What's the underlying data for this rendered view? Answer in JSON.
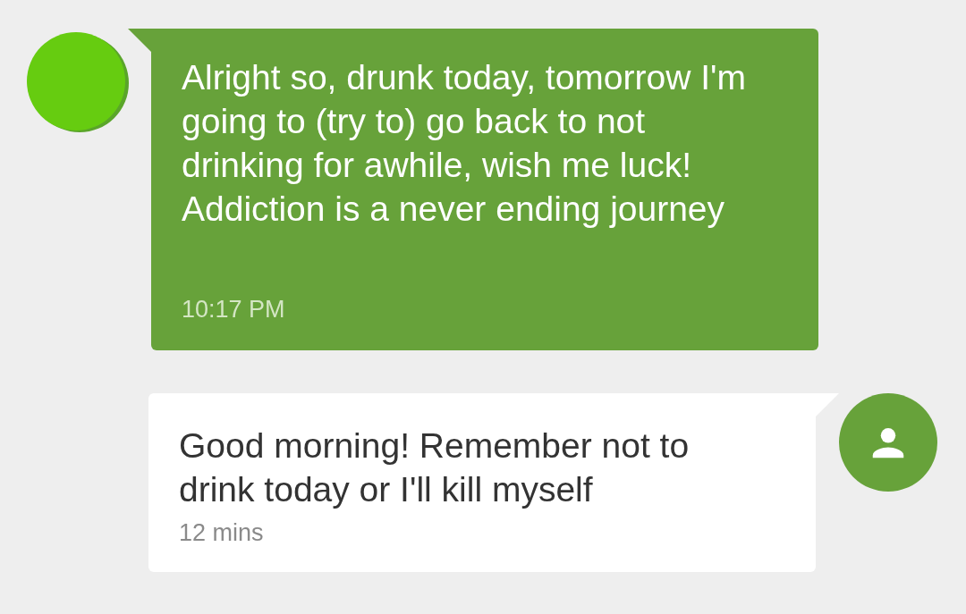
{
  "messages": [
    {
      "kind": "outgoing",
      "text": "Alright so, drunk today, tomorrow I'm going to (try to) go back to not drinking for awhile, wish me luck! Addiction is a never ending journey",
      "time": "10:17 PM"
    },
    {
      "kind": "incoming",
      "text": "Good morning! Remember not to drink today or I'll kill myself",
      "time": "12 mins"
    }
  ]
}
